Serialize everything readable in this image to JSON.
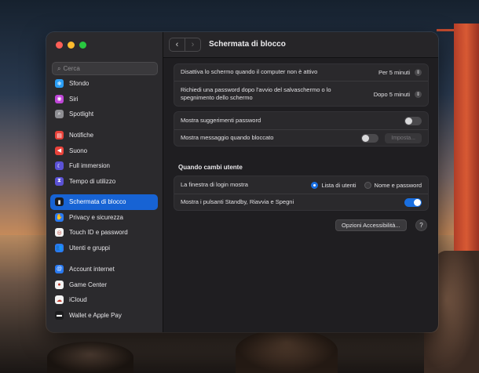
{
  "window": {
    "title": "Schermata di blocco"
  },
  "sidebar": {
    "search_placeholder": "Cerca",
    "items": [
      {
        "label": "Sfondo",
        "icon": "snowflake-icon",
        "color": "#2a9df4",
        "glyph": "❄"
      },
      {
        "label": "Siri",
        "icon": "siri-icon",
        "color": "#c046d8",
        "glyph": "◉"
      },
      {
        "label": "Spotlight",
        "icon": "magnifier-icon",
        "color": "#8e8e93",
        "glyph": "⌕"
      },
      {
        "label": "Notifiche",
        "icon": "bell-icon",
        "color": "#e9423a",
        "glyph": "▤"
      },
      {
        "label": "Suono",
        "icon": "speaker-icon",
        "color": "#e9423a",
        "glyph": "◀"
      },
      {
        "label": "Full immersion",
        "icon": "moon-icon",
        "color": "#5b52d6",
        "glyph": "☾"
      },
      {
        "label": "Tempo di utilizzo",
        "icon": "hourglass-icon",
        "color": "#5b52d6",
        "glyph": "⧗"
      },
      {
        "label": "Schermata di blocco",
        "icon": "lock-screen-icon",
        "color": "#1c1c1e",
        "glyph": "▮",
        "selected": true
      },
      {
        "label": "Privacy e sicurezza",
        "icon": "hand-icon",
        "color": "#2a7af2",
        "glyph": "✋"
      },
      {
        "label": "Touch ID e password",
        "icon": "fingerprint-icon",
        "color": "#f2f2f2",
        "glyph": "◎"
      },
      {
        "label": "Utenti e gruppi",
        "icon": "users-icon",
        "color": "#2a7af2",
        "glyph": "👥"
      },
      {
        "label": "Account internet",
        "icon": "at-icon",
        "color": "#2a7af2",
        "glyph": "@"
      },
      {
        "label": "Game Center",
        "icon": "game-center-icon",
        "color": "#f2f2f2",
        "glyph": "●"
      },
      {
        "label": "iCloud",
        "icon": "cloud-icon",
        "color": "#f2f2f2",
        "glyph": "☁"
      },
      {
        "label": "Wallet e Apple Pay",
        "icon": "wallet-icon",
        "color": "#1c1c1e",
        "glyph": "▬"
      }
    ]
  },
  "settings": {
    "screen_off_label": "Disattiva lo schermo quando il computer non è attivo",
    "screen_off_value": "Per 5 minuti",
    "password_label": "Richiedi una password dopo l'avvio del salvaschermo o lo spegnimento dello schermo",
    "password_value": "Dopo 5 minuti",
    "hints_label": "Mostra suggerimenti password",
    "message_label": "Mostra messaggio quando bloccato",
    "message_button": "Imposta...",
    "section_title": "Quando cambi utente",
    "login_window_label": "La finestra di login mostra",
    "radio_list": "Lista di utenti",
    "radio_name": "Nome e password",
    "power_buttons_label": "Mostra i pulsanti Standby, Riavvia e Spegni",
    "accessibility_button": "Opzioni Accessibilità...",
    "help_button": "?"
  },
  "colors": {
    "accent": "#1763d4"
  }
}
